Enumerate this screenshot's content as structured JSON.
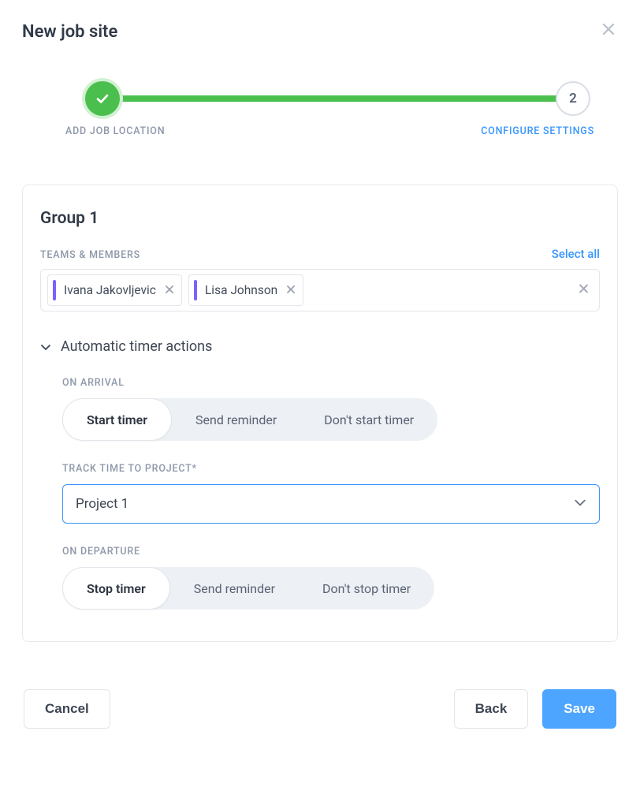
{
  "modal": {
    "title": "New job site"
  },
  "stepper": {
    "step2_number": "2",
    "label_left": "ADD JOB LOCATION",
    "label_right": "CONFIGURE SETTINGS"
  },
  "group": {
    "title": "Group 1",
    "teams_label": "TEAMS & MEMBERS",
    "select_all": "Select all",
    "members": [
      {
        "name": "Ivana Jakovljevic"
      },
      {
        "name": "Lisa Johnson"
      }
    ]
  },
  "automatic": {
    "section_title": "Automatic timer actions",
    "on_arrival": {
      "label": "ON ARRIVAL",
      "options": [
        "Start timer",
        "Send reminder",
        "Don't start timer"
      ],
      "selected": "Start timer"
    },
    "track_project": {
      "label": "TRACK TIME TO PROJECT*",
      "value": "Project 1"
    },
    "on_departure": {
      "label": "ON DEPARTURE",
      "options": [
        "Stop timer",
        "Send reminder",
        "Don't stop timer"
      ],
      "selected": "Stop timer"
    }
  },
  "footer": {
    "cancel": "Cancel",
    "back": "Back",
    "save": "Save"
  }
}
